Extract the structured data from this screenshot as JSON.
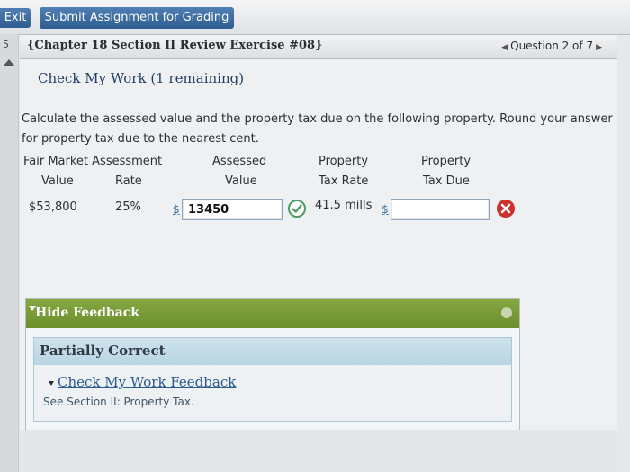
{
  "topbar": {
    "exit_label": "Exit",
    "submit_label": "Submit Assignment for Grading"
  },
  "leftstrip": {
    "number": "5"
  },
  "header": {
    "chapter_title": "{Chapter 18 Section II Review Exercise #08}",
    "question_nav": "Question 2 of 7"
  },
  "main": {
    "check_my_work": "Check My Work (1 remaining)",
    "question_line1": "Calculate the assessed value and the property tax due on the following property. Round your answer",
    "question_line2": "for property tax due to the nearest cent.",
    "headers": {
      "fair_market": "Fair Market Assessment",
      "assessed": "Assessed",
      "property1": "Property",
      "property2": "Property",
      "value": "Value",
      "rate": "Rate",
      "assessed_value": "Value",
      "tax_rate": "Tax Rate",
      "tax_due": "Tax Due"
    },
    "row": {
      "fair_market_value": "$53,800",
      "rate": "25%",
      "dollar1": "$",
      "assessed_value": "13450",
      "tax_rate": "41.5 mills",
      "dollar2": "$",
      "tax_due": ""
    }
  },
  "feedback": {
    "hide_label": "Hide Feedback",
    "result_title": "Partially Correct",
    "link_label": "Check My Work Feedback",
    "hint": "See Section II: Property Tax."
  },
  "colors": {
    "accent_blue": "#2f5d8f",
    "feedback_green": "#7a9c37",
    "correct_green": "#4c9a63",
    "wrong_red": "#c9322f"
  }
}
